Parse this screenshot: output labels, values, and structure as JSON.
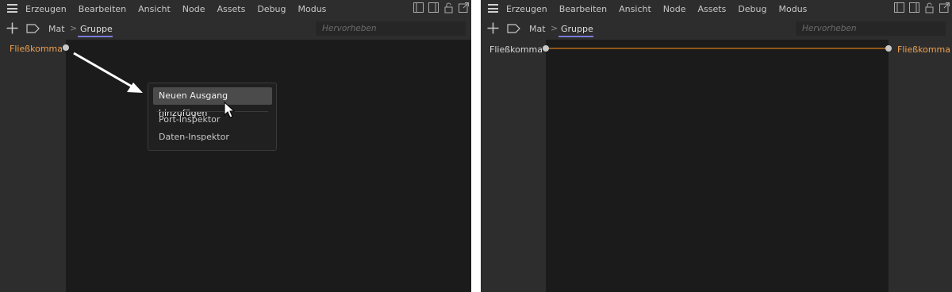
{
  "menu": [
    "Erzeugen",
    "Bearbeiten",
    "Ansicht",
    "Node",
    "Assets",
    "Debug",
    "Modus"
  ],
  "window_icons": [
    "layout-icon",
    "panel-icon",
    "lock-icon",
    "popout-icon"
  ],
  "breadcrumb": {
    "parent": "Mat",
    "separator": ">",
    "current": "Gruppe"
  },
  "search": {
    "placeholder": "Hervorheben"
  },
  "left_panel": {
    "input_port": "Fließkomma",
    "context_menu": {
      "highlighted": "Neuen Ausgang hinzufügen",
      "items": [
        "Port-Inspektor",
        "Daten-Inspektor"
      ]
    }
  },
  "right_panel": {
    "input_port": "Fließkomma",
    "output_port": "Fließkomma",
    "wire_color": "#b86a18"
  },
  "colors": {
    "port_orange": "#f0a050",
    "tab_underline": "#7a7ad8"
  }
}
